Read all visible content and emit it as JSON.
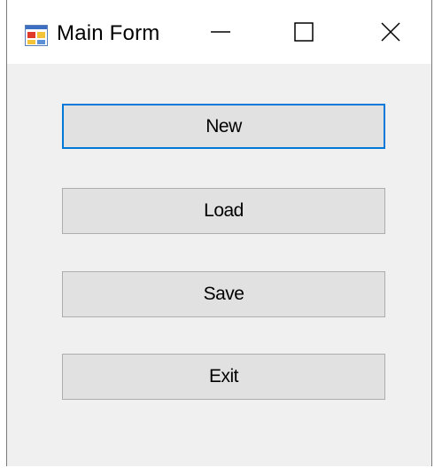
{
  "window": {
    "title": "Main Form",
    "icon": "winforms-app-icon",
    "controls": {
      "minimize_icon": "minimize-icon",
      "maximize_icon": "maximize-icon",
      "close_icon": "close-icon"
    }
  },
  "buttons": {
    "new_label": "New",
    "load_label": "Load",
    "save_label": "Save",
    "exit_label": "Exit"
  },
  "colors": {
    "focus_border": "#0078d7",
    "button_face": "#e1e1e1",
    "form_background": "#f0f0f0"
  }
}
